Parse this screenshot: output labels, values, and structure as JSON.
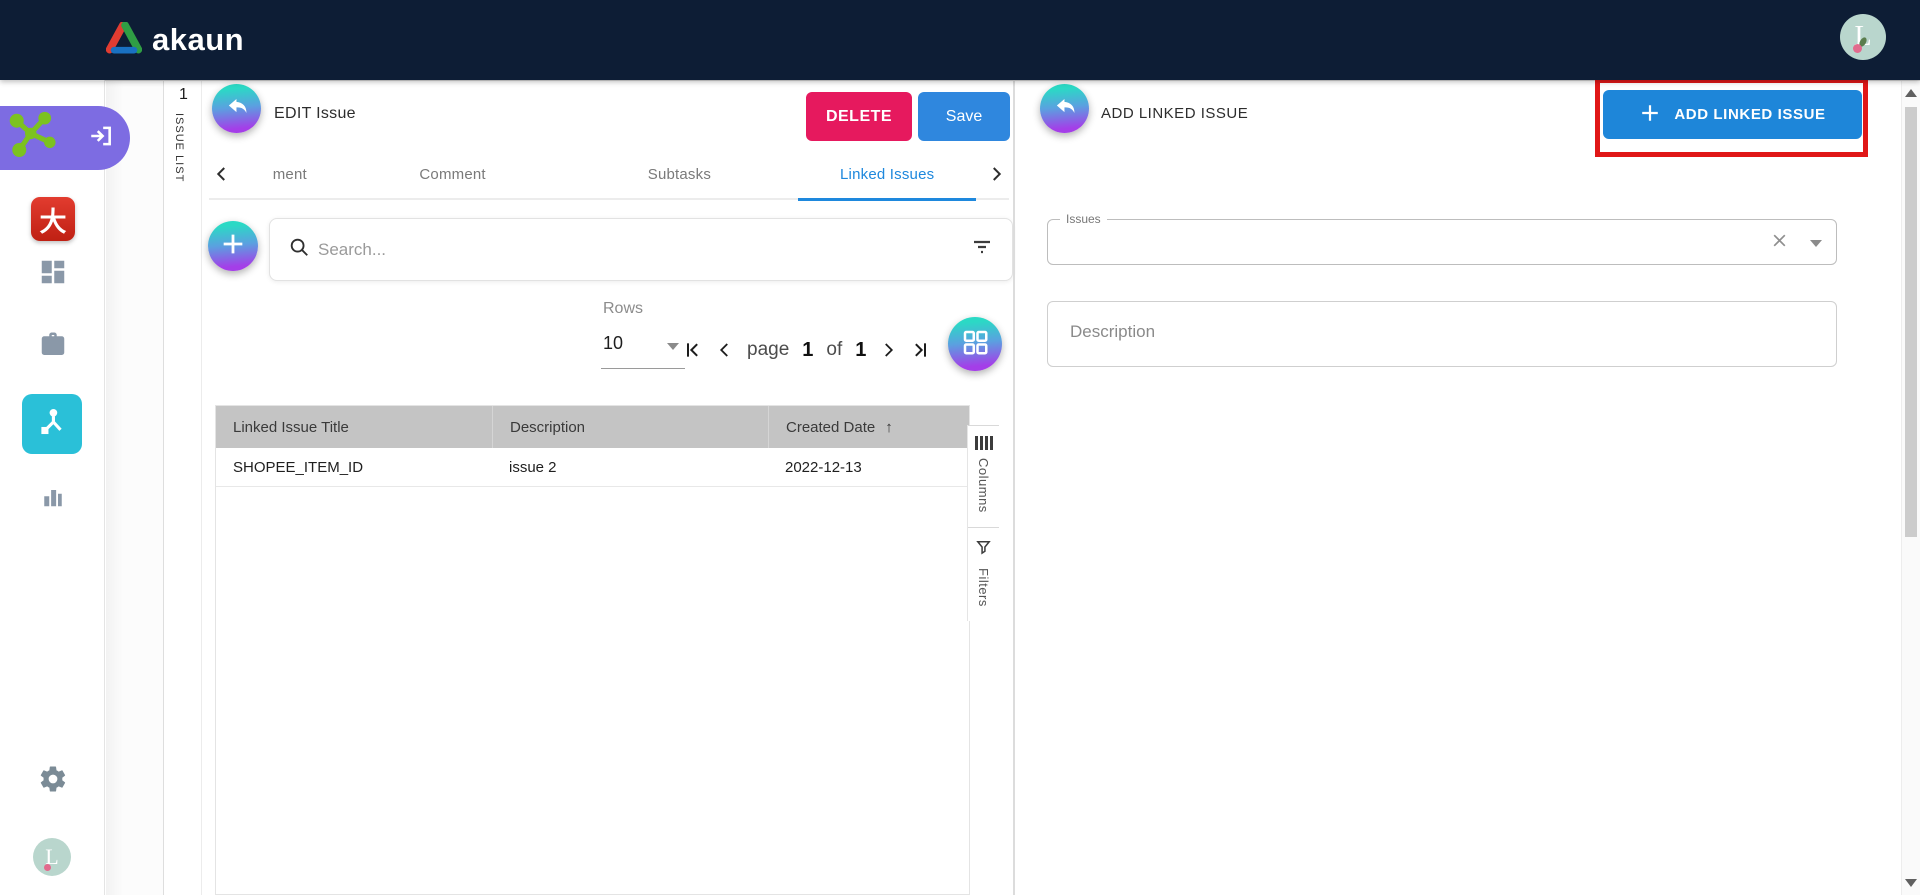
{
  "navbar": {
    "brand": "akaun",
    "avatar_initial": "L"
  },
  "sidebar": {
    "app_glyph": "大",
    "avatar_initial": "L"
  },
  "issue_strip": {
    "count": "1",
    "label": "ISSUE LIST"
  },
  "edit_panel": {
    "title": "EDIT Issue",
    "delete_button": "DELETE",
    "save_button": "Save",
    "tabs": [
      "ment",
      "Comment",
      "Subtasks",
      "Linked Issues"
    ],
    "search": {
      "placeholder": "Search..."
    },
    "rows": {
      "label": "Rows",
      "value": "10"
    },
    "pagination": {
      "page_word": "page",
      "current": "1",
      "of_word": "of",
      "total": "1"
    },
    "table": {
      "col1": "Linked Issue Title",
      "col2": "Description",
      "col3": "Created Date",
      "sort_arrow": "↑",
      "row1": {
        "c1": "SHOPEE_ITEM_ID",
        "c2": "issue 2",
        "c3": "2022-12-13"
      }
    },
    "side_tabs": {
      "columns": "Columns",
      "filters": "Filters"
    }
  },
  "add_panel": {
    "title": "ADD LINKED ISSUE",
    "add_button": "ADD LINKED ISSUE",
    "issues_label": "Issues",
    "description_placeholder": "Description"
  },
  "colors": {
    "navbar_bg": "#0d1d35",
    "delete_pink": "#e6195e",
    "save_blue": "#2f87de",
    "add_button_blue": "#1e86d9",
    "active_tab_blue": "#1e88dd",
    "gradient_teal": "#2bd9c5",
    "gradient_purple": "#a43ee8",
    "sidebar_active_teal": "#2ac0d8",
    "sidebar_banner_purple": "#7d6ce2",
    "annotation_red": "#e01717",
    "table_header_gray": "#c4c4c4"
  }
}
